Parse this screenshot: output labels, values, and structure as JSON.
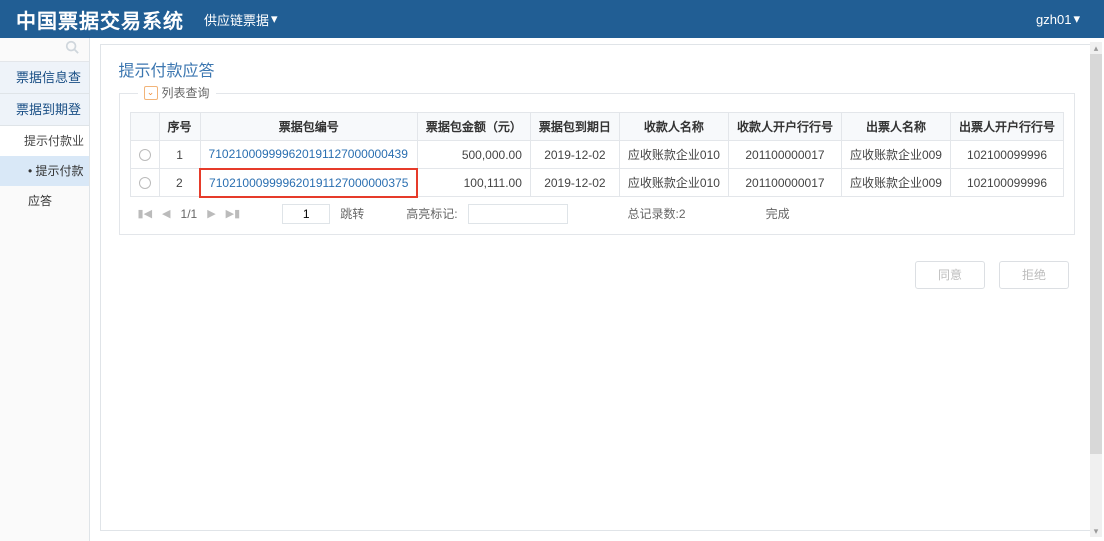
{
  "header": {
    "brand": "中国票据交易系统",
    "module": "供应链票据",
    "user": "gzh01"
  },
  "sidebar": {
    "items": [
      {
        "label": "票据信息查询",
        "kind": "group"
      },
      {
        "label": "票据到期登记",
        "kind": "group"
      },
      {
        "label": "提示付款业务",
        "kind": "sub"
      },
      {
        "label": "• 提示付款应答",
        "kind": "sub-active"
      }
    ]
  },
  "page": {
    "title": "提示付款应答",
    "section_title": "列表查询"
  },
  "table": {
    "headers": [
      "序号",
      "票据包编号",
      "票据包金额（元）",
      "票据包到期日",
      "收款人名称",
      "收款人开户行行号",
      "出票人名称",
      "出票人开户行行号"
    ],
    "rows": [
      {
        "idx": "1",
        "pkg_no": "710210009999620191127000000439",
        "amount": "500,000.00",
        "due": "2019-12-02",
        "payee": "应收账款企业010",
        "payee_bank": "201100000017",
        "drawer": "应收账款企业009",
        "drawer_bank": "102100099996",
        "highlight": false
      },
      {
        "idx": "2",
        "pkg_no": "710210009999620191127000000375",
        "amount": "100,111.00",
        "due": "2019-12-02",
        "payee": "应收账款企业010",
        "payee_bank": "201100000017",
        "drawer": "应收账款企业009",
        "drawer_bank": "102100099996",
        "highlight": true
      }
    ]
  },
  "pager": {
    "page_info": "1/1",
    "page_input": "1",
    "jump_label": "跳转",
    "highlight_label": "高亮标记:",
    "highlight_value": "",
    "total_label": "总记录数:2",
    "status": "完成"
  },
  "actions": {
    "agree": "同意",
    "reject": "拒绝"
  }
}
